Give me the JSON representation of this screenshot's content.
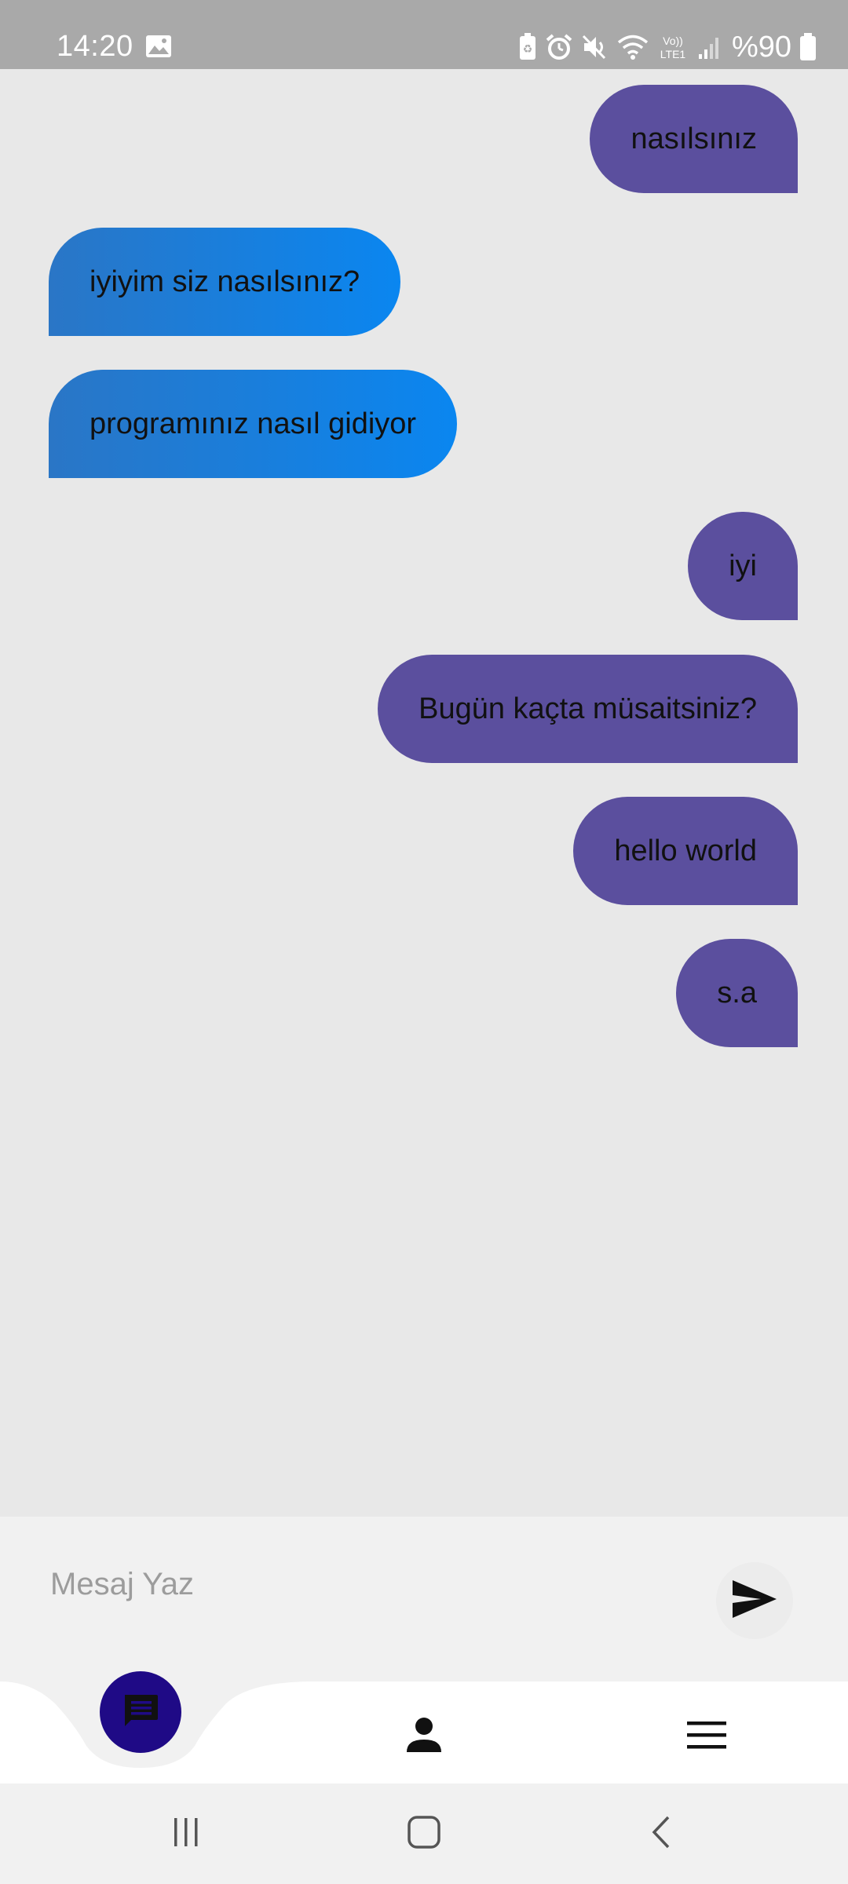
{
  "status_bar": {
    "time": "14:20",
    "battery": "%90",
    "icons": [
      "gallery-icon",
      "battery-saver-icon",
      "alarm-icon",
      "mute-icon",
      "wifi-icon",
      "volte-icon",
      "signal-icon",
      "battery-icon"
    ]
  },
  "messages": [
    {
      "text": "nasılsınız",
      "side": "sent"
    },
    {
      "text": "iyiyim siz nasılsınız?",
      "side": "received"
    },
    {
      "text": "programınız nasıl gidiyor",
      "side": "received"
    },
    {
      "text": "iyi",
      "side": "sent"
    },
    {
      "text": "Bugün kaçta müsaitsiniz?",
      "side": "sent"
    },
    {
      "text": "hello world",
      "side": "sent"
    },
    {
      "text": "s.a",
      "side": "sent"
    }
  ],
  "composer": {
    "placeholder": "Mesaj Yaz",
    "value": "",
    "send_icon": "send-icon"
  },
  "bottom_nav": {
    "items": [
      {
        "icon": "chat-icon",
        "active": true
      },
      {
        "icon": "person-icon",
        "active": false
      },
      {
        "icon": "menu-icon",
        "active": false
      }
    ]
  },
  "system_nav": {
    "items": [
      "recent-apps-icon",
      "home-icon",
      "back-icon"
    ]
  },
  "colors": {
    "sent_bubble": "#5b4f9e",
    "received_bubble_start": "#2a76c6",
    "received_bubble_end": "#0a86f0",
    "chat_background": "#e8e8e8",
    "status_bar": "#a9a9a9",
    "active_nav": "#1f0a86"
  }
}
